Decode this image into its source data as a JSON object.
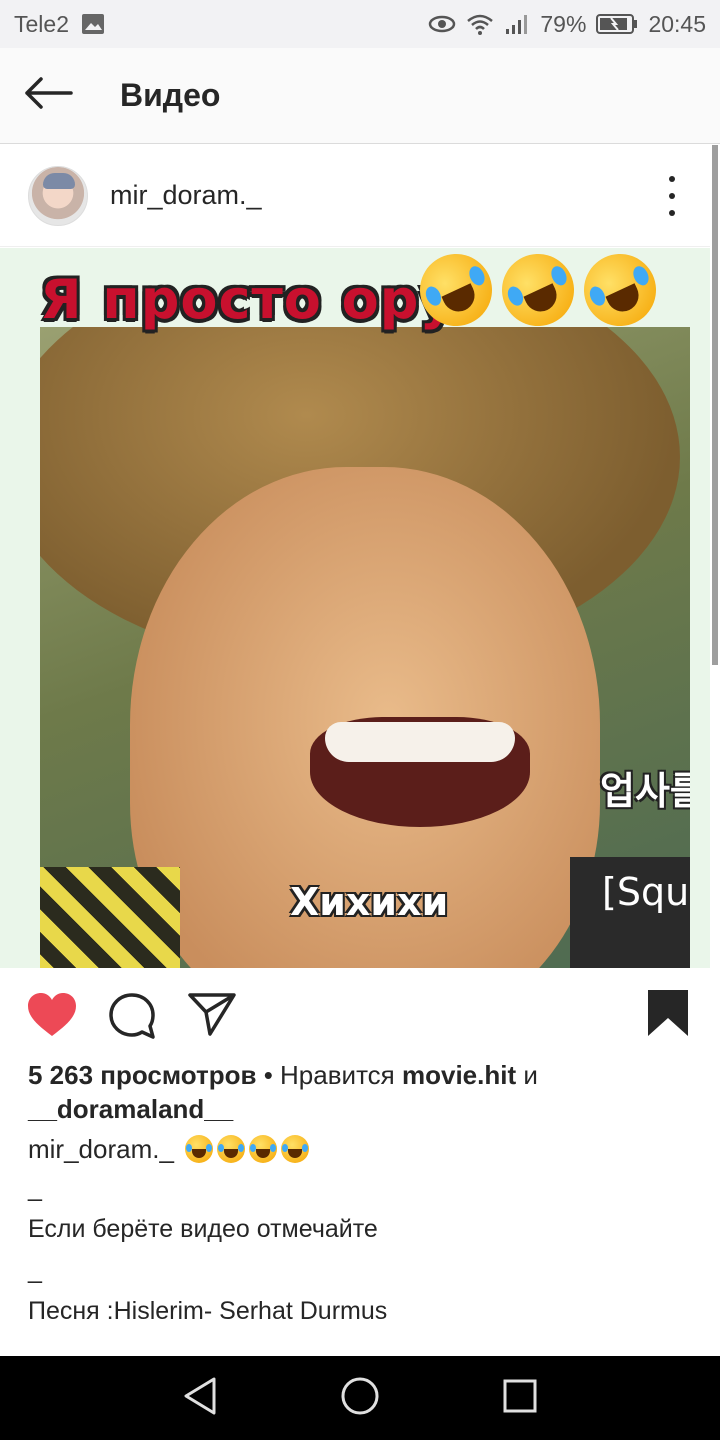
{
  "status_bar": {
    "carrier": "Tele2",
    "battery_percent": "79%",
    "time": "20:45",
    "icons": [
      "image-icon",
      "eye-icon",
      "wifi-icon",
      "signal-icon",
      "battery-icon"
    ]
  },
  "app_bar": {
    "title": "Видео",
    "back_icon": "back-arrow-icon"
  },
  "post": {
    "username": "mir_doram._",
    "media": {
      "overlay_text": "Я просто ору",
      "overlay_emoji": [
        "rolling-laughing-emoji",
        "rolling-laughing-emoji",
        "rolling-laughing-emoji"
      ],
      "subtitle": "Хихихи",
      "side_text_korean": "업사를",
      "side_text_latin": "[Squa"
    },
    "actions": {
      "like_icon": "heart-icon",
      "comment_icon": "comment-icon",
      "share_icon": "send-icon",
      "save_icon": "bookmark-icon",
      "liked": true
    },
    "views_count": "5 263 просмотров",
    "likes_separator": " • Нравится ",
    "liked_by_1": "movie.hit",
    "liked_by_conjunction": " и",
    "liked_by_2": "__doramaland__",
    "caption_user": "mir_doram._",
    "caption_lines": [
      "_",
      "Если берёте видео отмечайте",
      "_",
      "Песня :Hislerim- Serhat Durmus",
      "_"
    ]
  },
  "nav_bar": {
    "icons": [
      "back-triangle-icon",
      "home-circle-icon",
      "recents-square-icon"
    ]
  },
  "colors": {
    "like_red": "#ed4956",
    "text": "#262626",
    "nav_bg": "#000000"
  }
}
